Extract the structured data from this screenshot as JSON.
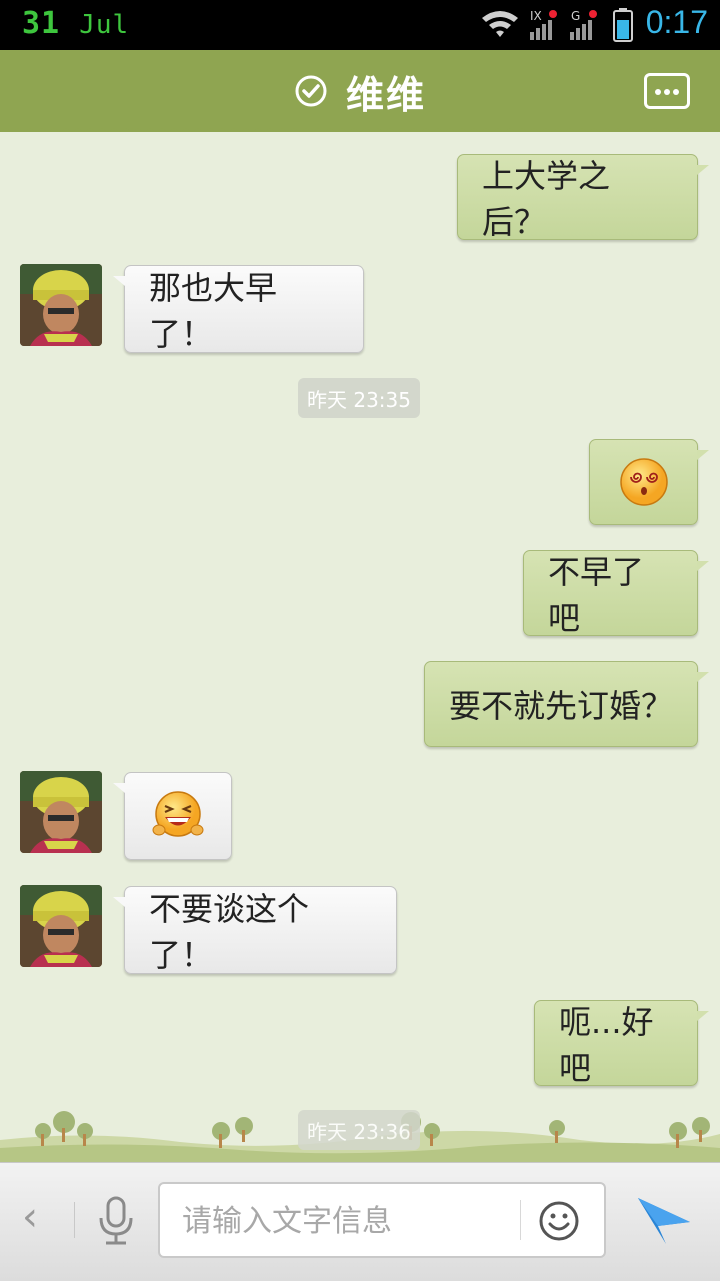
{
  "status_bar": {
    "day": "31",
    "month": "Jul",
    "time": "0:17"
  },
  "header": {
    "title": "维维"
  },
  "messages": [
    {
      "side": "out",
      "text": "上大学之后？"
    },
    {
      "side": "in",
      "text": "那也大早了！"
    },
    {
      "type": "time",
      "text": "昨天 23:35"
    },
    {
      "side": "out",
      "emoji": "dizzy-face"
    },
    {
      "side": "out",
      "text": "不早了吧"
    },
    {
      "side": "out",
      "text": "要不就先订婚？"
    },
    {
      "side": "in",
      "emoji": "laughing-face"
    },
    {
      "side": "in",
      "text": "不要谈这个了！"
    },
    {
      "side": "out",
      "text": "呃...好吧"
    },
    {
      "type": "time",
      "text": "昨天 23:36"
    }
  ],
  "input_bar": {
    "back_label": "‹",
    "placeholder": "请输入文字信息"
  },
  "colors": {
    "header": "#8fa551",
    "outgoing_bubble": "#c8d9a0",
    "incoming_bubble": "#f0f0f0",
    "background": "#e8eedc",
    "send_icon": "#2a85d6"
  }
}
